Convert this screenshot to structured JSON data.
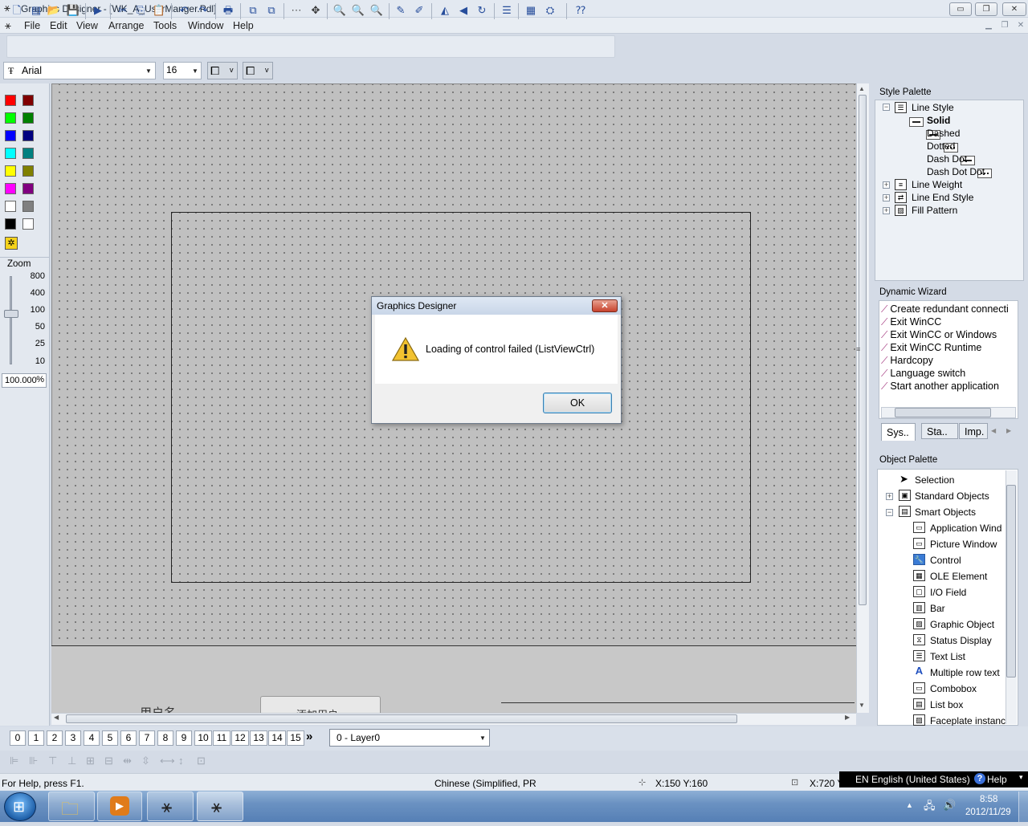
{
  "window": {
    "title": "Graphics Designer - [WK_A_UserManger.Pdl]",
    "minimize": "▭",
    "restore": "❐",
    "close": "✕"
  },
  "menu": {
    "items": [
      "File",
      "Edit",
      "View",
      "Arrange",
      "Tools",
      "Window",
      "Help"
    ]
  },
  "font_toolbar": {
    "font_name": "Arial",
    "font_size": "16"
  },
  "zoom": {
    "label": "Zoom",
    "levels": [
      "800",
      "400",
      "100",
      "50",
      "25",
      "10"
    ],
    "value": "100.000",
    "unit": "%"
  },
  "colors": {
    "palette": [
      "#ff0000",
      "#800000",
      "#00ff00",
      "#008000",
      "#0000ff",
      "#000080",
      "#00ffff",
      "#008080",
      "#ffff00",
      "#808000",
      "#ff00ff",
      "#800080",
      "#ffffff",
      "#808080",
      "#000000",
      "#ffffff"
    ],
    "canvas": "#c0c0c0"
  },
  "canvas": {
    "below_fragment_left": "用户名",
    "below_fragment_button": "添加用户"
  },
  "style_palette": {
    "title": "Style Palette",
    "line_style": "Line Style",
    "styles": [
      "Solid",
      "Dashed",
      "Dotted",
      "Dash Dot",
      "Dash Dot Dot"
    ],
    "line_weight": "Line Weight",
    "line_end_style": "Line End Style",
    "fill_pattern": "Fill Pattern"
  },
  "dynamic_wizard": {
    "title": "Dynamic Wizard",
    "items": [
      "Create redundant connecti",
      "Exit WinCC",
      "Exit WinCC or Windows",
      "Exit WinCC Runtime",
      "Hardcopy",
      "Language switch",
      "Start another application"
    ],
    "tabs": [
      "Sys..",
      "Sta..",
      "Imp."
    ]
  },
  "object_palette": {
    "title": "Object Palette",
    "selection": "Selection",
    "standard_objects": "Standard Objects",
    "smart_objects": "Smart Objects",
    "items": [
      "Application Wind",
      "Picture Window",
      "Control",
      "OLE Element",
      "I/O Field",
      "Bar",
      "Graphic Object",
      "Status Display",
      "Text List",
      "Multiple row text",
      "Combobox",
      "List box",
      "Faceplate instanc"
    ]
  },
  "dialog": {
    "title": "Graphics Designer",
    "message": "Loading of control failed (ListViewCtrl)",
    "ok": "OK",
    "close": "✕"
  },
  "layers": {
    "buttons": [
      "0",
      "1",
      "2",
      "3",
      "4",
      "5",
      "6",
      "7",
      "8",
      "9",
      "10",
      "11",
      "12",
      "13",
      "14",
      "15"
    ],
    "more": "»",
    "selected": "0 - Layer0"
  },
  "statusbar": {
    "help": "For Help, press F1.",
    "language": "Chinese (Simplified, PR",
    "position": "X:150 Y:160",
    "size": "X:720 Y"
  },
  "langbar": {
    "language": "EN English (United States)",
    "help": "Help"
  },
  "tray": {
    "time": "8:58",
    "date": "2012/11/29"
  }
}
